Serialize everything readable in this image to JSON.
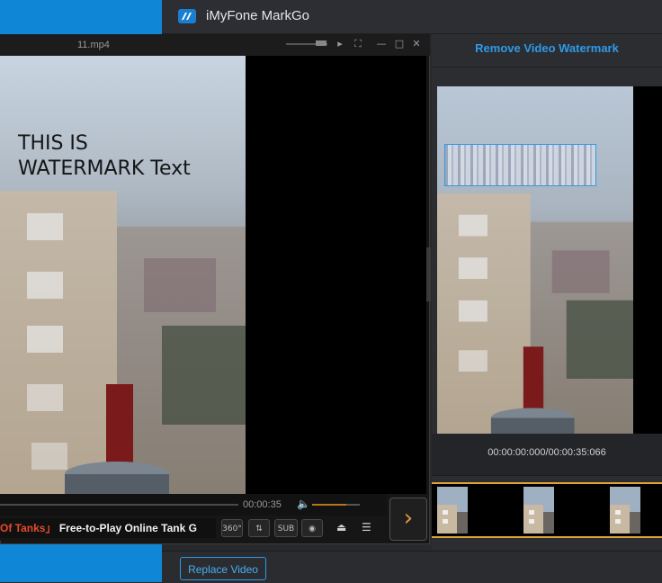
{
  "app": {
    "title": "iMyFone MarkGo",
    "panel_title": "Remove Video Watermark",
    "timecode": "00:00:00:000/00:00:35:066",
    "replace_button": "Replace Video",
    "colors": {
      "accent": "#2f9ae8",
      "timeline_border": "#e0a33a"
    }
  },
  "player": {
    "filename": "11.mp4",
    "watermark_text": "THIS IS\nWATERMARK Text",
    "seek_time": "00:00:35",
    "ad_prefix": "Of Tanks」",
    "ad_text": "Free-to-Play Online Tank G",
    "buttons": {
      "b360": "360°",
      "sub": "SUB"
    },
    "icons": [
      "minimize-icon",
      "maximize-icon",
      "close-icon",
      "speaker-icon",
      "camera-icon",
      "eject-icon",
      "playlist-icon",
      "chevron-right-icon"
    ]
  }
}
